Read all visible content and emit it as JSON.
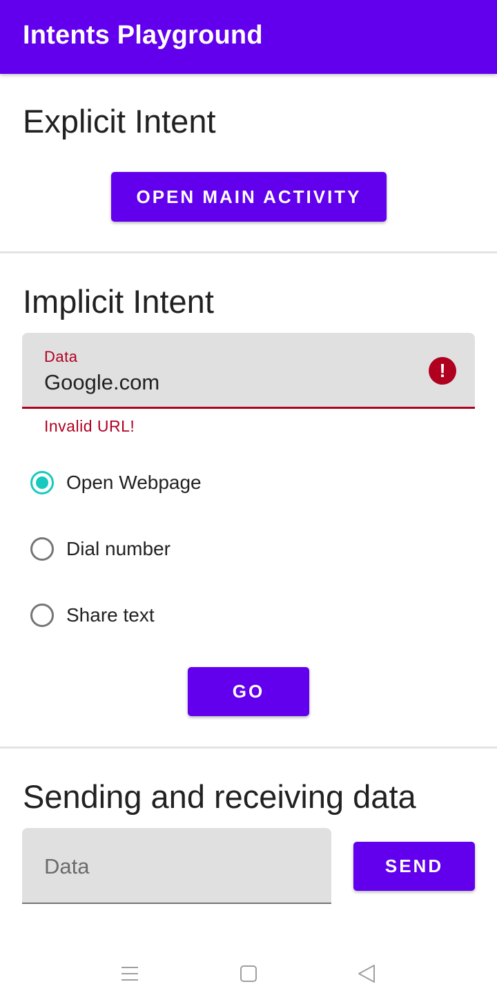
{
  "appbar": {
    "title": "Intents Playground"
  },
  "explicit": {
    "title": "Explicit Intent",
    "button_label": "OPEN MAIN ACTIVITY"
  },
  "implicit": {
    "title": "Implicit Intent",
    "field_label": "Data",
    "field_value": "Google.com",
    "error_text": "Invalid URL!",
    "options": [
      {
        "label": "Open Webpage",
        "checked": true
      },
      {
        "label": "Dial number",
        "checked": false
      },
      {
        "label": "Share text",
        "checked": false
      }
    ],
    "go_label": "GO"
  },
  "sending": {
    "title": "Sending and receiving data",
    "placeholder": "Data",
    "send_label": "SEND"
  },
  "colors": {
    "primary": "#6200ee",
    "error": "#b00020",
    "radio_accent": "#17c9be"
  },
  "icons": {
    "error": "error-exclamation-icon",
    "nav_menu": "menu-lines-icon",
    "nav_home": "square-home-icon",
    "nav_back": "triangle-back-icon"
  }
}
